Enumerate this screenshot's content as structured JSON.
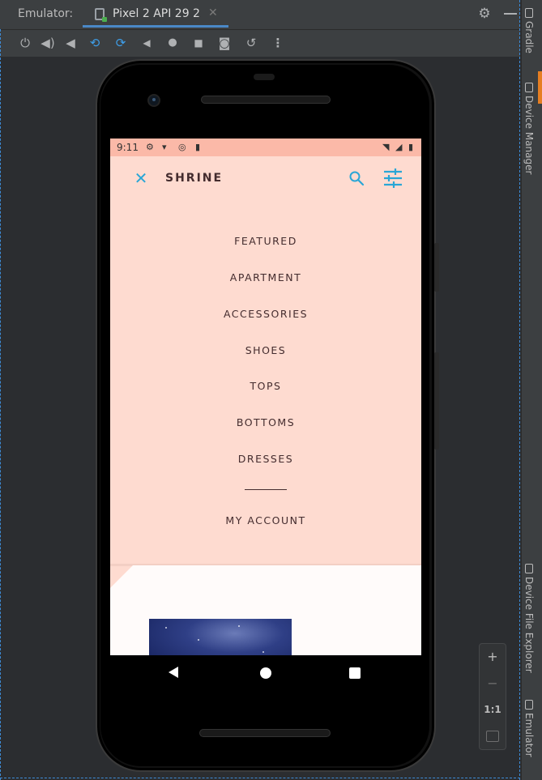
{
  "ide": {
    "tool_window_label": "Emulator:",
    "device_tab": {
      "label": "Pixel 2 API 29 2",
      "close": "✕"
    },
    "settings_icon": "gear-icon",
    "minimize_icon": "minimize-icon",
    "toolbar": [
      {
        "name": "power-icon",
        "glyph": "⏻"
      },
      {
        "name": "volume-up-icon",
        "glyph": "🔊"
      },
      {
        "name": "volume-down-icon",
        "glyph": "🔉"
      },
      {
        "name": "rotate-left-icon",
        "glyph": "⟲"
      },
      {
        "name": "rotate-right-icon",
        "glyph": "⟳"
      },
      {
        "name": "back-icon",
        "glyph": "◀"
      },
      {
        "name": "home-icon",
        "glyph": "●"
      },
      {
        "name": "overview-icon",
        "glyph": "■"
      },
      {
        "name": "screenshot-icon",
        "glyph": "📷"
      },
      {
        "name": "snapshot-icon",
        "glyph": "↺"
      },
      {
        "name": "more-options-icon",
        "glyph": "⋮"
      }
    ],
    "right_tabs": [
      "Gradle",
      "Device Manager",
      "Device File Explorer",
      "Emulator"
    ],
    "zoom": {
      "plus": "+",
      "minus": "−",
      "one_to_one": "1:1"
    }
  },
  "device": {
    "status_bar": {
      "time": "9:11"
    },
    "app": {
      "brand": "SHRINE",
      "menu": [
        "FEATURED",
        "APARTMENT",
        "ACCESSORIES",
        "SHOES",
        "TOPS",
        "BOTTOMS",
        "DRESSES"
      ],
      "account": "MY ACCOUNT"
    }
  },
  "colors": {
    "accent": "#2aa6d6",
    "backdrop": "#fedbd0",
    "status_bar": "#fbb9a8",
    "text": "#442c2e",
    "front_layer": "#fffbfa"
  }
}
